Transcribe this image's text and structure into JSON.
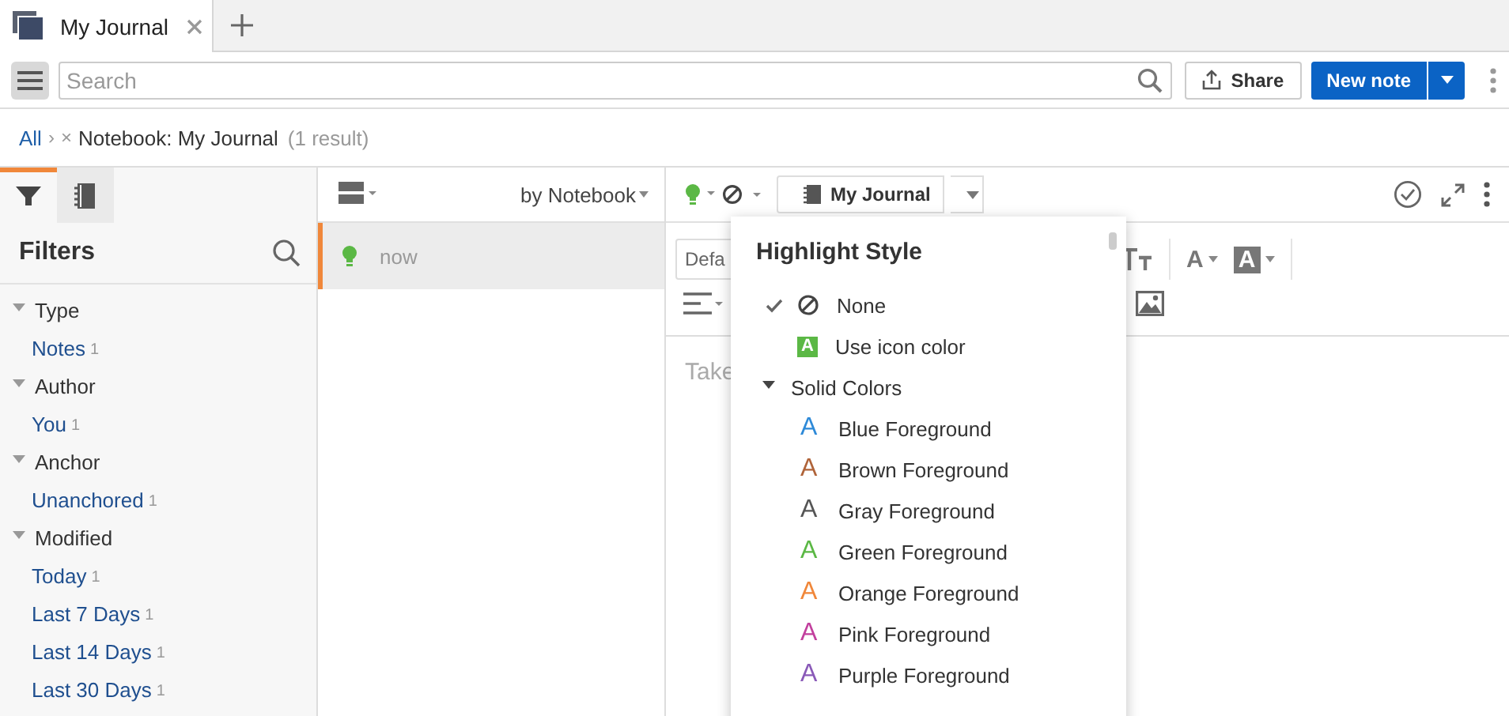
{
  "tabs": [
    {
      "title": "My Journal",
      "selected": true
    }
  ],
  "toolbar": {
    "search_placeholder": "Search",
    "share": "Share",
    "new_note": "New note"
  },
  "breadcrumb": {
    "root": "All",
    "separator": "›",
    "remove": "×",
    "filter": "Notebook: My Journal",
    "count": "(1 result)"
  },
  "sidebar": {
    "tabs": [
      {
        "kind": "filter",
        "selected": true
      },
      {
        "kind": "notebook",
        "selected": false
      }
    ],
    "title": "Filters",
    "groups": [
      {
        "label": "Type",
        "expanded": true,
        "children": [
          {
            "label": "Notes",
            "count": "1"
          }
        ]
      },
      {
        "label": "Author",
        "expanded": true,
        "children": [
          {
            "label": "You",
            "count": "1"
          }
        ]
      },
      {
        "label": "Anchor",
        "expanded": true,
        "children": [
          {
            "label": "Unanchored",
            "count": "1"
          }
        ]
      },
      {
        "label": "Modified",
        "expanded": true,
        "children": [
          {
            "label": "Today",
            "count": "1"
          },
          {
            "label": "Last 7 Days",
            "count": "1"
          },
          {
            "label": "Last 14 Days",
            "count": "1"
          },
          {
            "label": "Last 30 Days",
            "count": "1"
          }
        ]
      }
    ]
  },
  "list": {
    "sort": "by Notebook",
    "notes": [
      {
        "title": "now",
        "selected": true
      }
    ]
  },
  "editor": {
    "notebook": "My Journal",
    "font_field": "Defa",
    "font_color": "A",
    "highlight": "A",
    "placeholder": "Take"
  },
  "highlight_menu": {
    "title": "Highlight Style",
    "options": [
      {
        "kind": "none",
        "label": "None",
        "selected": true
      },
      {
        "kind": "icon_color",
        "glyph": "A",
        "label": "Use icon color",
        "selected": false
      }
    ],
    "section": {
      "label": "Solid Colors",
      "expanded": true,
      "items": [
        {
          "glyph": "A",
          "label": "Blue Foreground",
          "color": "#2e8ad8"
        },
        {
          "glyph": "A",
          "label": "Brown Foreground",
          "color": "#b0643a"
        },
        {
          "glyph": "A",
          "label": "Gray Foreground",
          "color": "#555555"
        },
        {
          "glyph": "A",
          "label": "Green Foreground",
          "color": "#5bb845"
        },
        {
          "glyph": "A",
          "label": "Orange Foreground",
          "color": "#f0873a"
        },
        {
          "glyph": "A",
          "label": "Pink Foreground",
          "color": "#c2409e"
        },
        {
          "glyph": "A",
          "label": "Purple Foreground",
          "color": "#8a5ab8"
        }
      ]
    }
  }
}
